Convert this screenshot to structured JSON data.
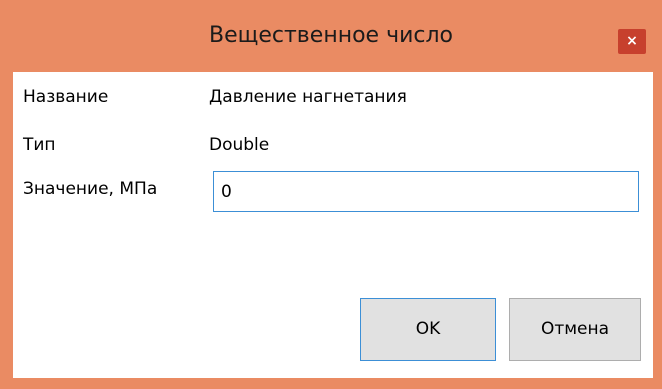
{
  "window": {
    "title": "Вещественное число",
    "close_glyph": "×",
    "colors": {
      "frame": "#ea8b63",
      "close_button": "#c7402d",
      "focus_border": "#3c8fd6"
    }
  },
  "fields": {
    "name_label": "Название",
    "name_value": "Давление нагнетания",
    "type_label": "Тип",
    "type_value": "Double",
    "value_label": "Значение, МПа",
    "value_input": "0"
  },
  "buttons": {
    "ok_label": "OK",
    "cancel_label": "Отмена"
  }
}
